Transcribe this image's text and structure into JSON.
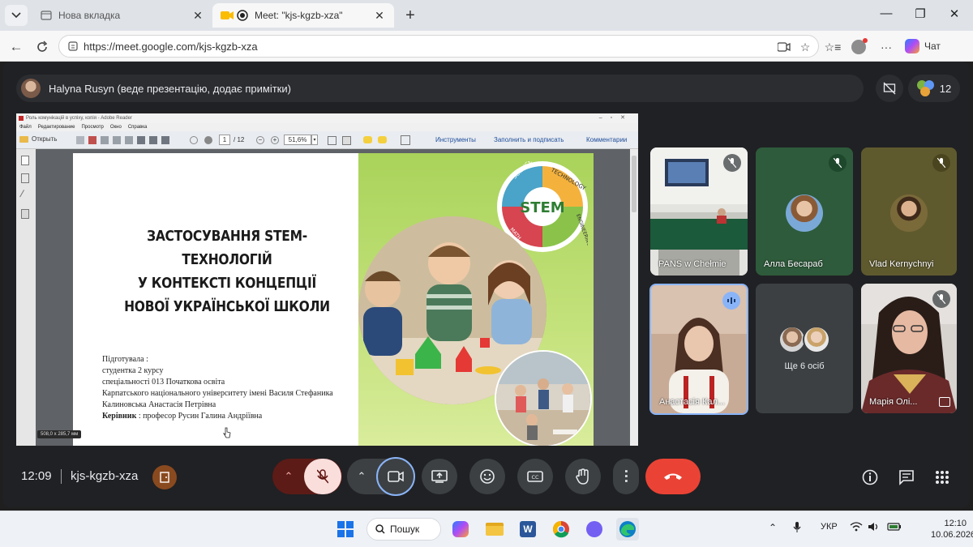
{
  "browser": {
    "tabs": [
      {
        "title": "Нова вкладка",
        "active": false
      },
      {
        "title": "Meet: \"kjs-kgzb-xza\"",
        "active": true
      }
    ],
    "url": "https://meet.google.com/kjs-kgzb-xza",
    "chat_label": "Чат"
  },
  "meet": {
    "presenter_text": "Halyna Rusyn (веде презентацію, додає примітки)",
    "participant_count": "12",
    "time": "12:09",
    "meeting_code": "kjs-kgzb-xza",
    "colors": {
      "end_call": "#ea4335",
      "mic_off_bg": "#f9dedc",
      "accent": "#8ab4f8"
    }
  },
  "reader": {
    "window_title": "Роль комунікацій в успіху, копія - Adobe Reader",
    "menu": [
      "Файл",
      "Редактирование",
      "Просмотр",
      "Окно",
      "Справка"
    ],
    "open_label": "Открыть",
    "page_current": "1",
    "page_total": "/ 12",
    "zoom": "51,6%",
    "panel_links": [
      "Инструменты",
      "Заполнить и подписать",
      "Комментарии"
    ],
    "page_size": "508,0 x 285,7 мм"
  },
  "slide": {
    "title_lines": [
      "ЗАСТОСУВАННЯ STEM-ТЕХНОЛОГІЙ",
      "У КОНТЕКСТІ КОНЦЕПЦІЇ",
      "НОВОЇ УКРАЇНСЬКОЇ ШКОЛИ"
    ],
    "info_lines": [
      "Підготувала :",
      "студентка 2 курсу",
      "спеціальності 013 Початкова освіта",
      "Карпатського національного університету імені Василя Стефаника",
      "Калиновська Анастасія Петрівна"
    ],
    "supervisor_label": "Керівник",
    "supervisor_value": ": професор  Русин Галина Андріївна",
    "badge": {
      "center": "STEM",
      "science": "SCIENCE",
      "technology": "TECHNOLOGY",
      "engineering": "ENGINEERING",
      "math": "MATH"
    }
  },
  "participants": [
    {
      "name": "PANS w Chełmie",
      "muted": true
    },
    {
      "name": "Алла Бесараб",
      "muted": true
    },
    {
      "name": "Vlad Kernychnyi",
      "muted": true
    },
    {
      "name": "Анастасія Кал...",
      "speaking": true
    },
    {
      "name": "Ще 6 осіб"
    },
    {
      "name": "Марія Олі...",
      "muted": true
    }
  ],
  "taskbar": {
    "search_label": "Пошук",
    "language": "УКР",
    "time": "12:10",
    "date": "10.06.2026"
  }
}
